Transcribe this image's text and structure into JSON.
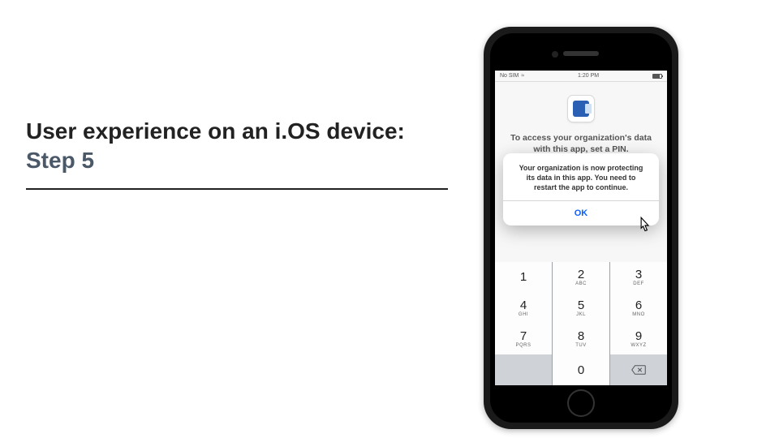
{
  "slide": {
    "title_line1": "User experience on an i.OS device:",
    "title_line2": "Step 5"
  },
  "phone": {
    "status": {
      "carrier": "No SIM",
      "wifi": "≈",
      "time": "1:20 PM",
      "battery": "■"
    },
    "app": {
      "icon_name": "outlook-icon",
      "heading": "To access your organization's data with this app, set a PIN."
    },
    "alert": {
      "message": "Your organization is now protecting its data in this app. You need to restart the app to continue.",
      "ok_label": "OK"
    },
    "keypad": {
      "keys": [
        [
          {
            "n": "1",
            "s": ""
          },
          {
            "n": "2",
            "s": "ABC"
          },
          {
            "n": "3",
            "s": "DEF"
          }
        ],
        [
          {
            "n": "4",
            "s": "GHI"
          },
          {
            "n": "5",
            "s": "JKL"
          },
          {
            "n": "6",
            "s": "MNO"
          }
        ],
        [
          {
            "n": "7",
            "s": "PQRS"
          },
          {
            "n": "8",
            "s": "TUV"
          },
          {
            "n": "9",
            "s": "WXYZ"
          }
        ],
        [
          {
            "n": "",
            "s": ""
          },
          {
            "n": "0",
            "s": ""
          },
          {
            "n": "⌫",
            "s": ""
          }
        ]
      ]
    }
  }
}
